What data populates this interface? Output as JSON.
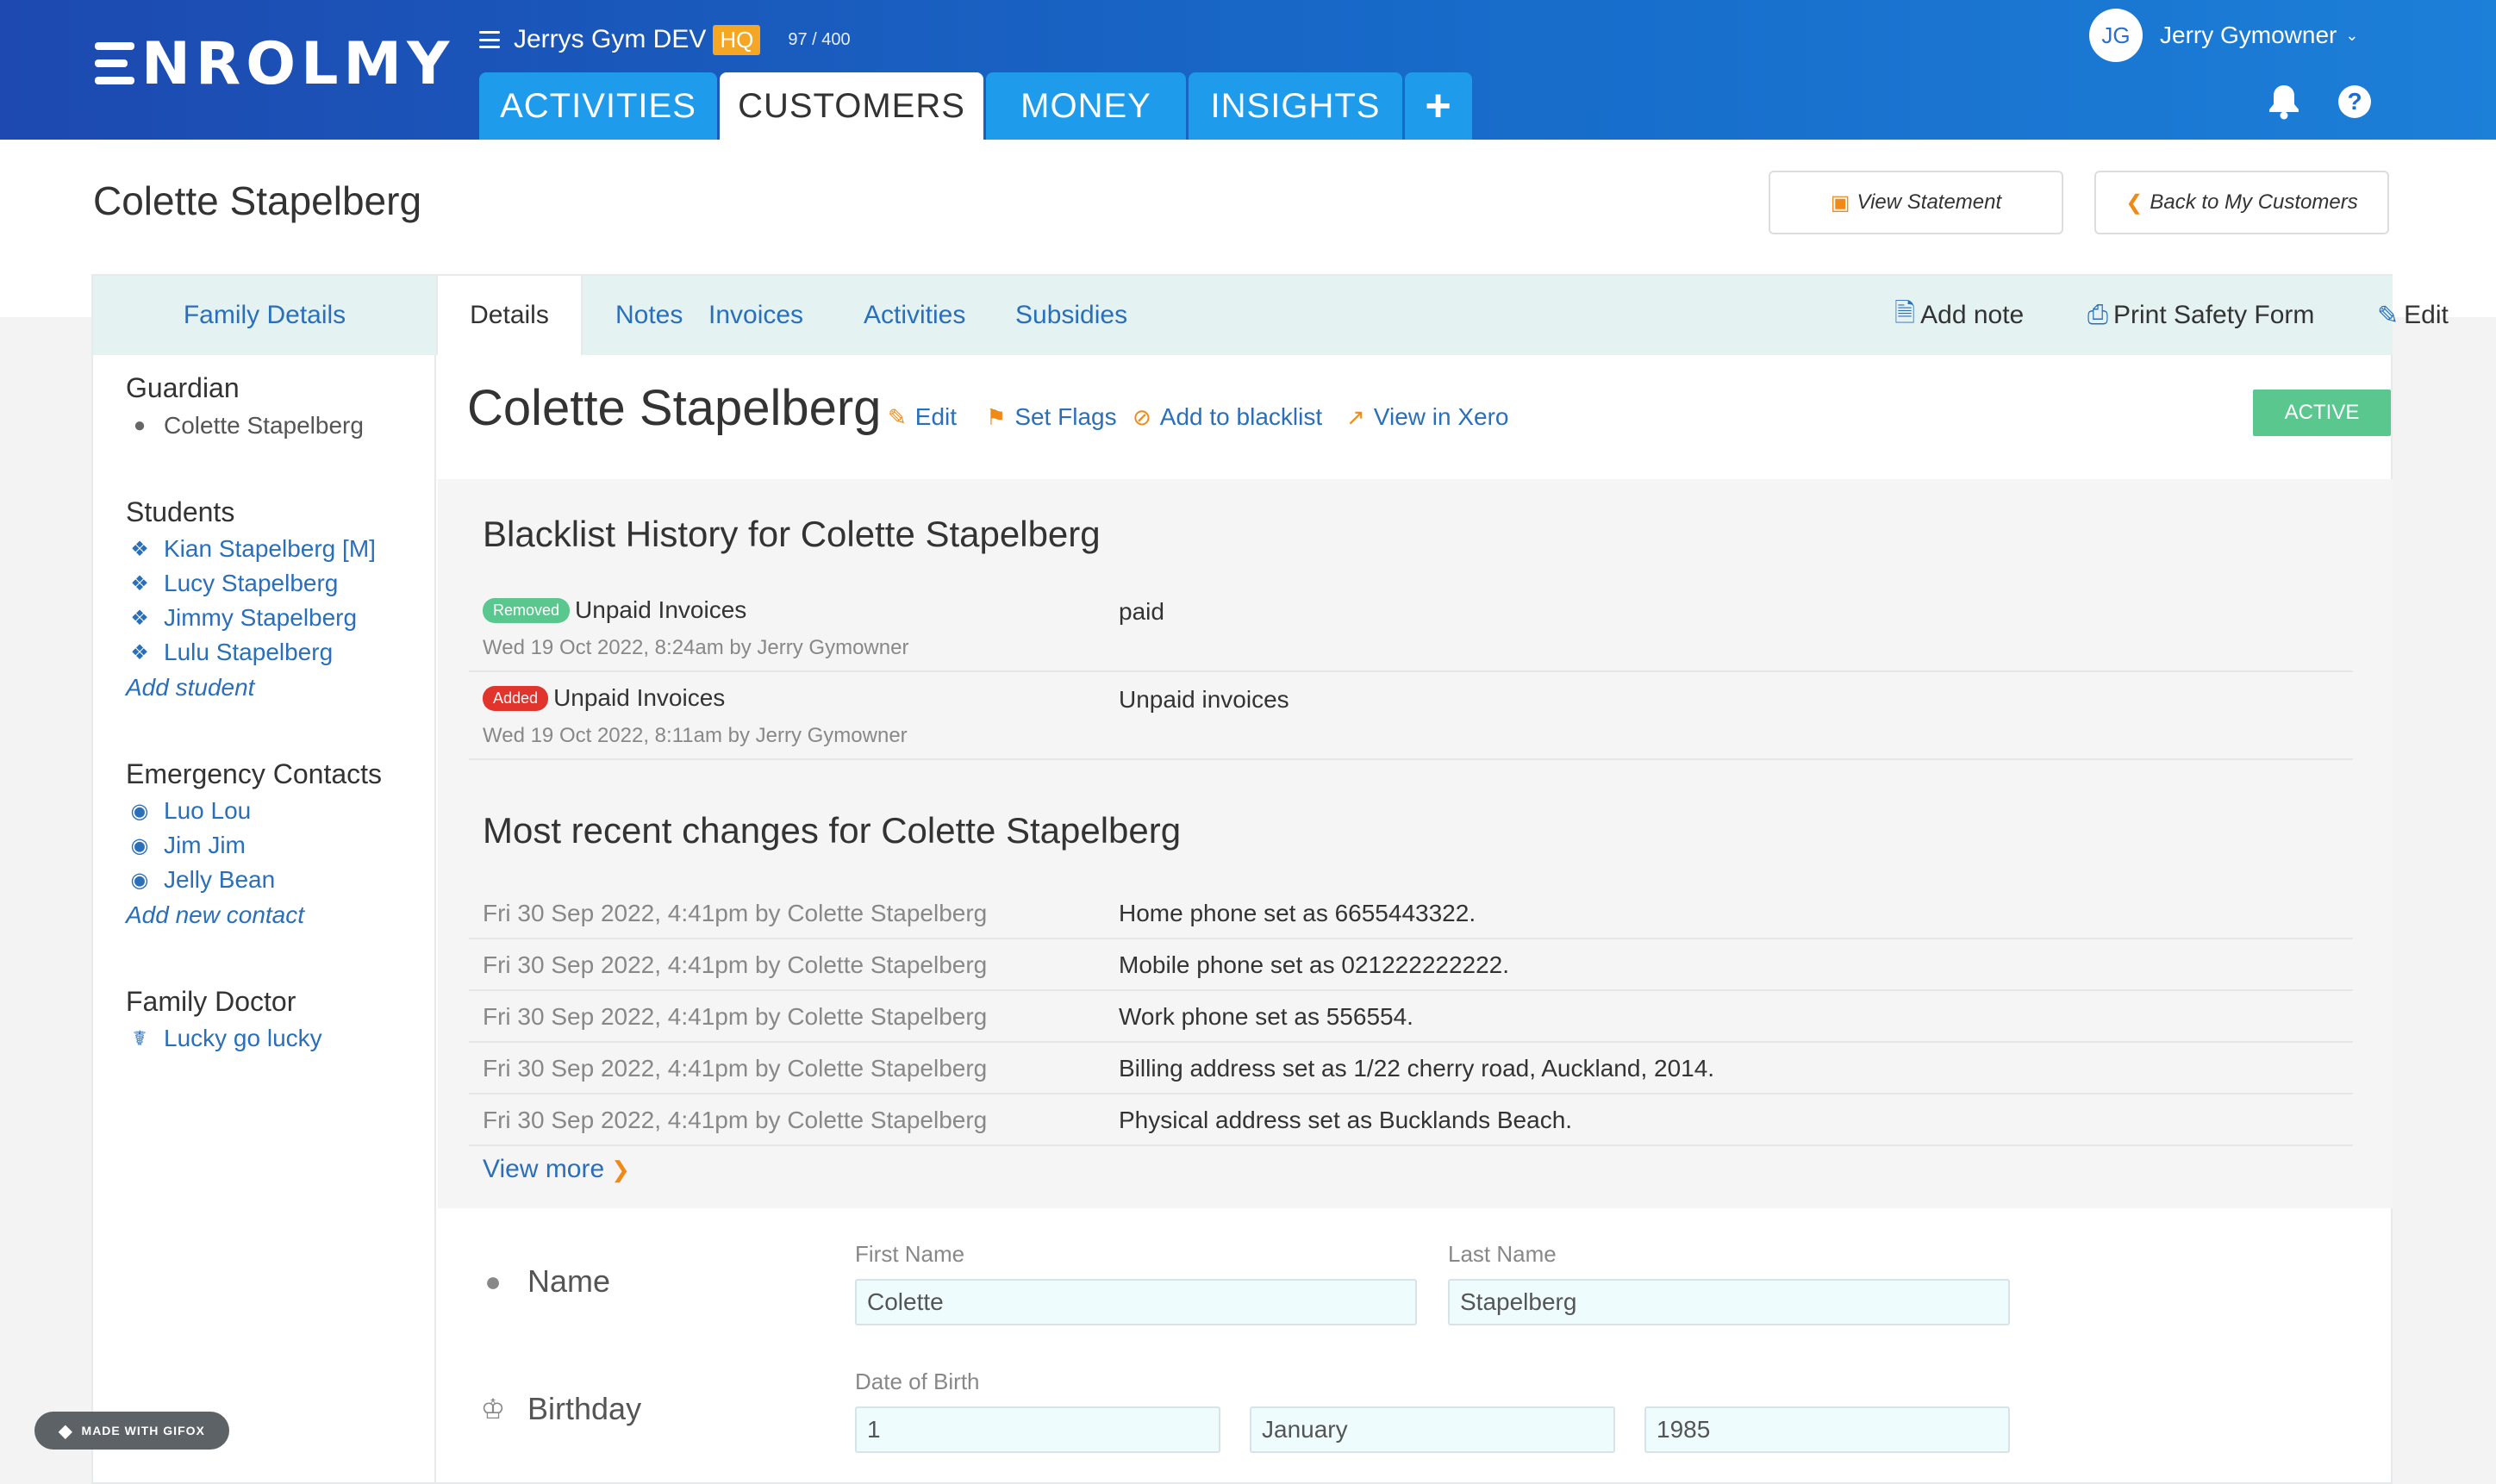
{
  "app": {
    "logo_text": "NROLMY"
  },
  "org": {
    "name": "Jerrys Gym DEV",
    "badge": "HQ",
    "quota": "97 / 400"
  },
  "nav": {
    "tabs": [
      "ACTIVITIES",
      "CUSTOMERS",
      "MONEY",
      "INSIGHTS"
    ],
    "active_tab": "CUSTOMERS"
  },
  "user": {
    "initials": "JG",
    "name": "Jerry Gymowner"
  },
  "header": {
    "title": "Colette Stapelberg",
    "view_statement": "View Statement",
    "back_to_customers": "Back to My Customers"
  },
  "sidebar": {
    "tab_label": "Family Details",
    "guardian": {
      "heading": "Guardian",
      "name": "Colette Stapelberg"
    },
    "students": {
      "heading": "Students",
      "items": [
        "Kian Stapelberg [M]",
        "Lucy Stapelberg",
        "Jimmy Stapelberg",
        "Lulu Stapelberg"
      ],
      "add_label": "Add student"
    },
    "emergency": {
      "heading": "Emergency Contacts",
      "items": [
        "Luo Lou",
        "Jim Jim",
        "Jelly Bean"
      ],
      "add_label": "Add new contact"
    },
    "doctor": {
      "heading": "Family Doctor",
      "name": "Lucky go lucky"
    }
  },
  "detail_tabs": [
    "Details",
    "Notes",
    "Invoices",
    "Activities",
    "Subsidies"
  ],
  "detail_actions": {
    "add_note": "Add note",
    "print_safety": "Print Safety Form",
    "edit": "Edit"
  },
  "customer": {
    "name": "Colette Stapelberg",
    "links": {
      "edit": "Edit",
      "flags": "Set Flags",
      "blacklist": "Add to blacklist",
      "xero": "View in Xero"
    },
    "status": "ACTIVE"
  },
  "blacklist": {
    "heading": "Blacklist History for Colette Stapelberg",
    "rows": [
      {
        "badge": "Removed",
        "title": "Unpaid Invoices",
        "meta": "Wed 19 Oct 2022, 8:24am by Jerry Gymowner",
        "note": "paid"
      },
      {
        "badge": "Added",
        "title": "Unpaid Invoices",
        "meta": "Wed 19 Oct 2022, 8:11am by Jerry Gymowner",
        "note": "Unpaid invoices"
      }
    ]
  },
  "changes": {
    "heading": "Most recent changes for Colette Stapelberg",
    "rows": [
      {
        "date": "Fri 30 Sep 2022, 4:41pm by Colette Stapelberg",
        "desc": "Home phone set as 6655443322."
      },
      {
        "date": "Fri 30 Sep 2022, 4:41pm by Colette Stapelberg",
        "desc": "Mobile phone set as 021222222222."
      },
      {
        "date": "Fri 30 Sep 2022, 4:41pm by Colette Stapelberg",
        "desc": "Work phone set as 556554."
      },
      {
        "date": "Fri 30 Sep 2022, 4:41pm by Colette Stapelberg",
        "desc": "Billing address set as 1/22 cherry road, Auckland, 2014."
      },
      {
        "date": "Fri 30 Sep 2022, 4:41pm by Colette Stapelberg",
        "desc": "Physical address set as Bucklands Beach."
      }
    ],
    "view_more": "View more"
  },
  "form": {
    "name_label": "Name",
    "first_name_caption": "First Name",
    "first_name": "Colette",
    "last_name_caption": "Last Name",
    "last_name": "Stapelberg",
    "birthday_label": "Birthday",
    "dob_caption": "Date of Birth",
    "dob_day": "1",
    "dob_month": "January",
    "dob_year": "1985"
  },
  "watermark": "MADE WITH GIFOX",
  "colors": {
    "brand_blue": "#1d49b0",
    "tab_blue": "#1e9bea",
    "link_blue": "#2a6fba",
    "accent_orange": "#f08a17",
    "active_green": "#5ac78f",
    "added_red": "#e0342c",
    "removed_green": "#5ac78f"
  }
}
